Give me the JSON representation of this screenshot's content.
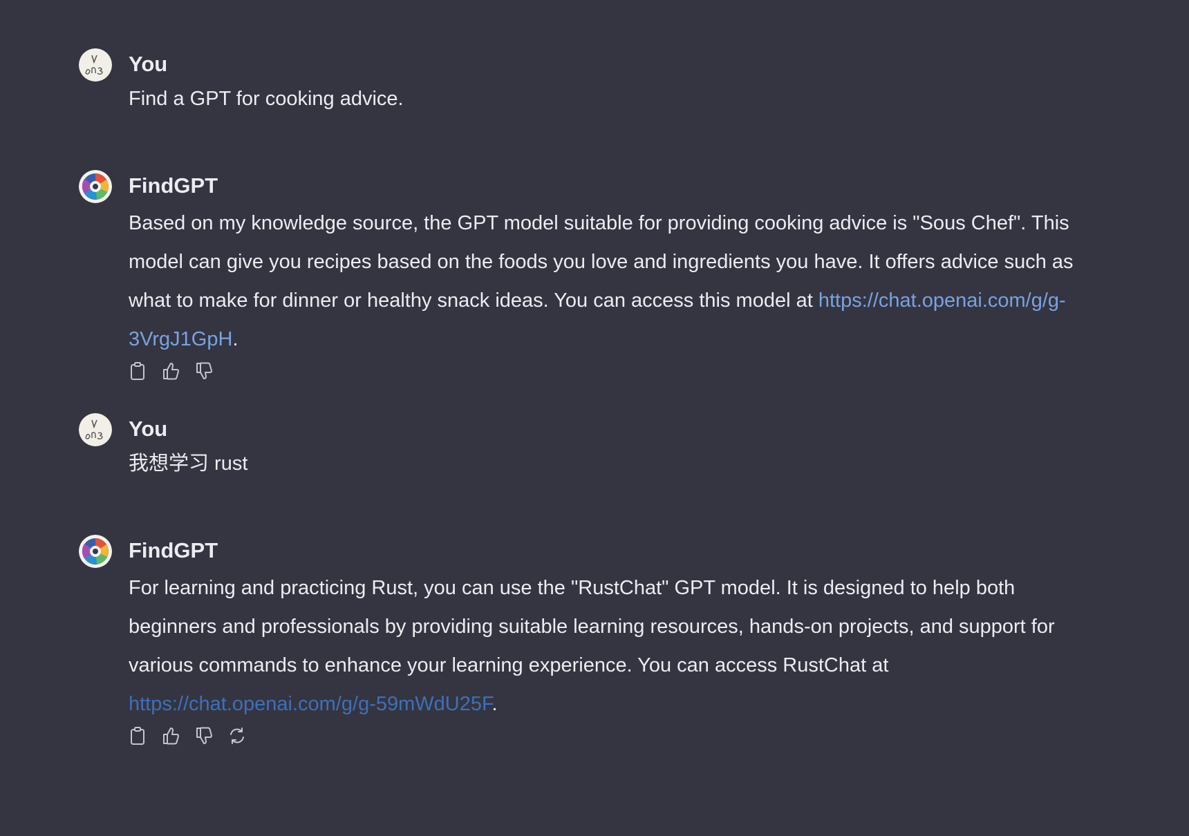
{
  "conversation": {
    "messages": [
      {
        "role": "user",
        "author": "You",
        "text": "Find a GPT for cooking advice."
      },
      {
        "role": "assistant",
        "author": "FindGPT",
        "text": "Based on my knowledge source, the GPT model suitable for providing cooking advice is \"Sous Chef\". This model can give you recipes based on the foods you love and ingredients you have. It offers advice such as what to make for dinner or healthy snack ideas. You can access this model at ",
        "link": "https://chat.openai.com/g/g-3VrgJ1GpH",
        "suffix": "."
      },
      {
        "role": "user",
        "author": "You",
        "text": "我想学习 rust"
      },
      {
        "role": "assistant",
        "author": "FindGPT",
        "text": "For learning and practicing Rust, you can use the \"RustChat\" GPT model. It is designed to help both beginners and professionals by providing suitable learning resources, hands-on projects, and support for various commands to enhance your learning experience. You can access RustChat at ",
        "link": "https://chat.openai.com/g/g-59mWdU25F",
        "suffix": "."
      }
    ]
  },
  "icons": {
    "copy": "clipboard-icon",
    "like": "thumbs-up-icon",
    "dislike": "thumbs-down-icon",
    "regenerate": "regenerate-icon"
  },
  "colors": {
    "background": "#343541",
    "text": "#ececf1",
    "link": "#7aa2e0",
    "link_dark": "#3f6fb8",
    "icon": "#c5c5d2"
  }
}
